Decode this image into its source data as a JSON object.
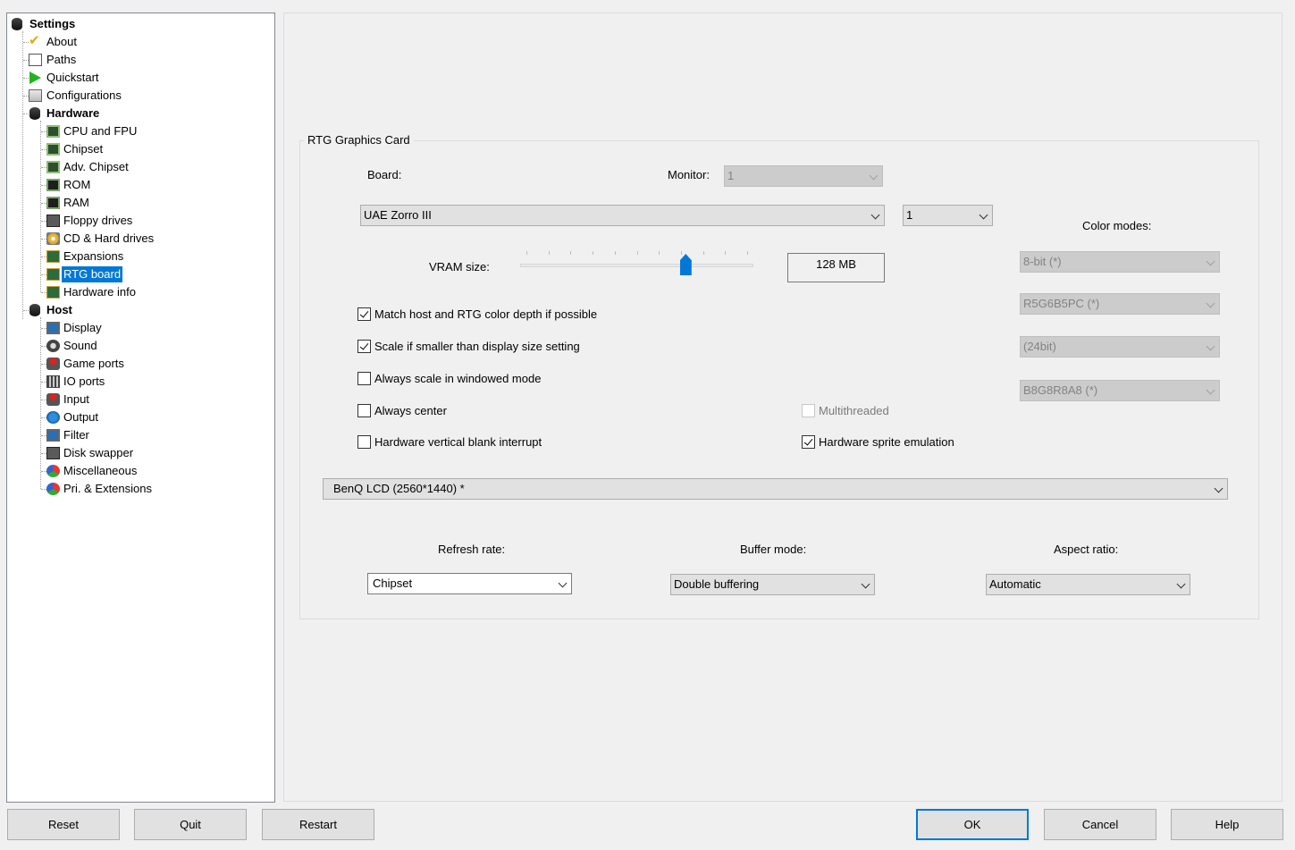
{
  "tree": {
    "root": "Settings",
    "items": [
      {
        "label": "About",
        "icon": "check-icon"
      },
      {
        "label": "Paths",
        "icon": "document-icon"
      },
      {
        "label": "Quickstart",
        "icon": "play-icon"
      },
      {
        "label": "Configurations",
        "icon": "config-icon"
      }
    ],
    "hardware": {
      "label": "Hardware",
      "items": [
        {
          "label": "CPU and FPU",
          "icon": "chip-icon"
        },
        {
          "label": "Chipset",
          "icon": "chip-icon"
        },
        {
          "label": "Adv. Chipset",
          "icon": "chip-icon"
        },
        {
          "label": "ROM",
          "icon": "chip-icon"
        },
        {
          "label": "RAM",
          "icon": "chip-icon"
        },
        {
          "label": "Floppy drives",
          "icon": "floppy-icon"
        },
        {
          "label": "CD & Hard drives",
          "icon": "cd-icon"
        },
        {
          "label": "Expansions",
          "icon": "card-icon"
        },
        {
          "label": "RTG board",
          "icon": "card-icon",
          "selected": true
        },
        {
          "label": "Hardware info",
          "icon": "card-icon"
        }
      ]
    },
    "host": {
      "label": "Host",
      "items": [
        {
          "label": "Display",
          "icon": "display-icon"
        },
        {
          "label": "Sound",
          "icon": "speaker-icon"
        },
        {
          "label": "Game ports",
          "icon": "joystick-icon"
        },
        {
          "label": "IO ports",
          "icon": "io-port-icon"
        },
        {
          "label": "Input",
          "icon": "joystick-icon"
        },
        {
          "label": "Output",
          "icon": "globe-icon"
        },
        {
          "label": "Filter",
          "icon": "display-icon"
        },
        {
          "label": "Disk swapper",
          "icon": "floppy-icon"
        },
        {
          "label": "Miscellaneous",
          "icon": "multi-icon"
        },
        {
          "label": "Pri. & Extensions",
          "icon": "multi-icon"
        }
      ]
    }
  },
  "rtg": {
    "group_title": "RTG Graphics Card",
    "board_label": "Board:",
    "monitor_label": "Monitor:",
    "monitor_value": "1",
    "board_value": "UAE Zorro III",
    "board_index_value": "1",
    "vram_label": "VRAM size:",
    "vram_value": "128 MB",
    "vram_slider_fraction": 0.71,
    "color_modes_label": "Color modes:",
    "color_modes": [
      "8-bit (*)",
      "R5G6B5PC (*)",
      "(24bit)",
      "B8G8R8A8 (*)"
    ],
    "checkboxes": [
      {
        "label": "Match host and RTG color depth if possible",
        "checked": true,
        "enabled": true
      },
      {
        "label": "Scale if smaller than display size setting",
        "checked": true,
        "enabled": true
      },
      {
        "label": "Always scale in windowed mode",
        "checked": false,
        "enabled": true
      },
      {
        "label": "Always center",
        "checked": false,
        "enabled": true
      },
      {
        "label": "Multithreaded",
        "checked": false,
        "enabled": false
      },
      {
        "label": "Hardware vertical blank interrupt",
        "checked": false,
        "enabled": true
      },
      {
        "label": "Hardware sprite emulation",
        "checked": true,
        "enabled": true
      }
    ],
    "display_value": "BenQ LCD (2560*1440) *",
    "refresh_label": "Refresh rate:",
    "refresh_value": "Chipset",
    "buffer_label": "Buffer mode:",
    "buffer_value": "Double buffering",
    "aspect_label": "Aspect ratio:",
    "aspect_value": "Automatic"
  },
  "buttons": {
    "reset": "Reset",
    "quit": "Quit",
    "restart": "Restart",
    "ok": "OK",
    "cancel": "Cancel",
    "help": "Help"
  },
  "colors": {
    "selection": "#0078d7",
    "slider_thumb": "#0078d7"
  }
}
